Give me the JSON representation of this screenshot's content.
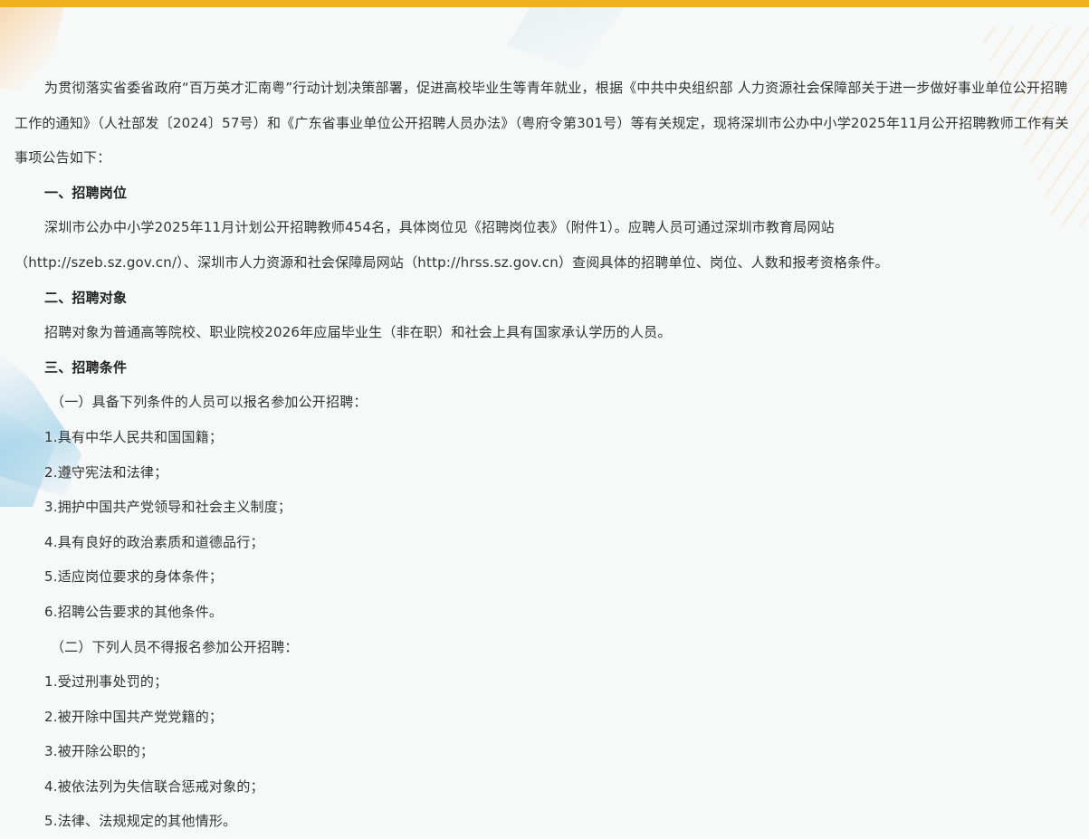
{
  "paragraphs": {
    "intro": "为贯彻落实省委省政府“百万英才汇南粤”行动计划决策部署，促进高校毕业生等青年就业，根据《中共中央组织部 人力资源社会保障部关于进一步做好事业单位公开招聘工作的通知》（人社部发〔2024〕57号）和《广东省事业单位公开招聘人员办法》（粤府令第301号）等有关规定，现将深圳市公办中小学2025年11月公开招聘教师工作有关事项公告如下：",
    "section1_title": "一、招聘岗位",
    "section1_body": "深圳市公办中小学2025年11月计划公开招聘教师454名，具体岗位见《招聘岗位表》（附件1）。应聘人员可通过深圳市教育局网站（http://szeb.sz.gov.cn/）、深圳市人力资源和社会保障局网站（http://hrss.sz.gov.cn）查阅具体的招聘单位、岗位、人数和报考资格条件。",
    "section1_body_line1": "深圳市公办中小学2025年11月计划公开招聘教师454名，具体岗位见《招聘岗位表》（附件1）。应聘人员可通过深圳市教育局网站",
    "section1_body_line2": "（http://szeb.sz.gov.cn/）、深圳市人力资源和社会保障局网站（http://hrss.sz.gov.cn）查阅具体的招聘单位、岗位、人数和报考资格条件。",
    "section2_title": "二、招聘对象",
    "section2_body": "招聘对象为普通高等院校、职业院校2026年应届毕业生（非在职）和社会上具有国家承认学历的人员。",
    "section3_title": "三、招聘条件",
    "sub1_title": "（一）具备下列条件的人员可以报名参加公开招聘：",
    "sub1_items": [
      "1.具有中华人民共和国国籍；",
      "2.遵守宪法和法律；",
      "3.拥护中国共产党领导和社会主义制度；",
      "4.具有良好的政治素质和道德品行；",
      "5.适应岗位要求的身体条件；",
      "6.招聘公告要求的其他条件。"
    ],
    "sub2_title": "（二）下列人员不得报名参加公开招聘：",
    "sub2_items": [
      "1.受过刑事处罚的；",
      "2.被开除中国共产党党籍的；",
      "3.被开除公职的；",
      "4.被依法列为失信联合惩戒对象的；",
      "5.法律、法规规定的其他情形。"
    ]
  },
  "colors": {
    "accent_bar": "#f0b21c",
    "background": "#f7f8f8",
    "text": "#333333"
  }
}
